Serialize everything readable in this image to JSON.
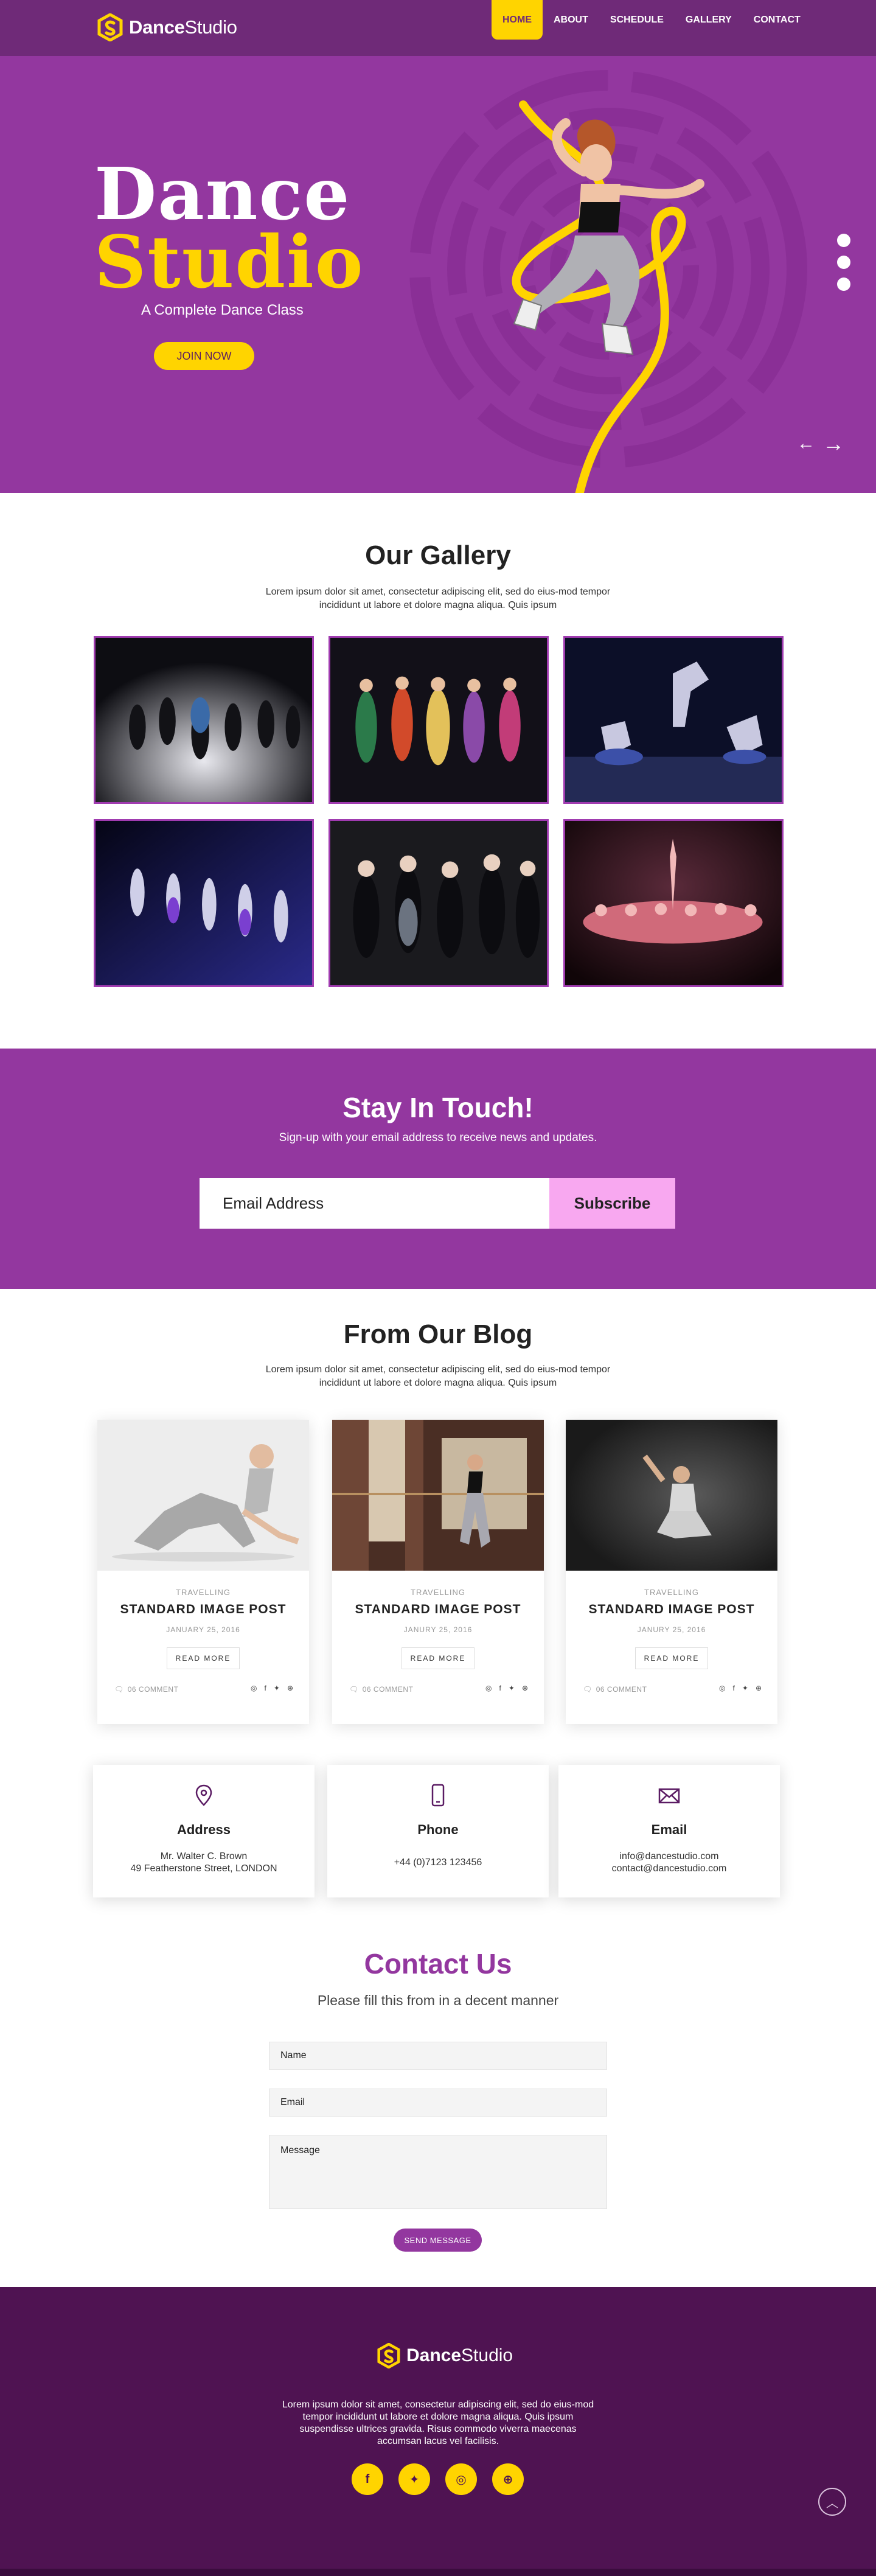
{
  "brand": {
    "name_bold": "Dance",
    "name_light": "Studio"
  },
  "nav": {
    "items": [
      "HOME",
      "ABOUT",
      "SCHEDULE",
      "GALLERY",
      "CONTACT"
    ],
    "active": "HOME"
  },
  "hero": {
    "title_line1": "Dance",
    "title_line2": "Studio",
    "tagline": "A Complete Dance Class",
    "cta": "JOIN NOW",
    "prev_arrow": "←",
    "next_arrow": "→"
  },
  "gallery": {
    "title": "Our Gallery",
    "subtitle": "Lorem ipsum dolor sit amet, consectetur adipiscing elit, sed do eius-mod tempor incididunt ut labore et dolore magna aliqua. Quis ipsum"
  },
  "newsletter": {
    "title": "Stay In Touch!",
    "subtitle": "Sign-up with your email address to receive news and updates.",
    "email_placeholder": "Email Address",
    "button": "Subscribe"
  },
  "blog": {
    "title": "From Our Blog",
    "subtitle": "Lorem ipsum dolor sit amet, consectetur adipiscing elit, sed do eius-mod tempor incididunt ut labore et dolore magna aliqua. Quis ipsum",
    "posts": [
      {
        "category": "TRAVELLING",
        "title": "STANDARD IMAGE POST",
        "date": "JANUARY 25, 2016",
        "more": "READ MORE",
        "comments": "06 COMMENT"
      },
      {
        "category": "TRAVELLING",
        "title": "STANDARD IMAGE POST",
        "date": "JANURY 25, 2016",
        "more": "READ MORE",
        "comments": "06 COMMENT"
      },
      {
        "category": "TRAVELLING",
        "title": "STANDARD IMAGE POST",
        "date": "JANURY 25, 2016",
        "more": "READ MORE",
        "comments": "06 COMMENT"
      }
    ]
  },
  "info": {
    "address": {
      "title": "Address",
      "line1": "Mr. Walter C. Brown",
      "line2": "49 Featherstone Street, LONDON"
    },
    "phone": {
      "title": "Phone",
      "line1": "+44 (0)7123 123456"
    },
    "email": {
      "title": "Email",
      "line1": "info@dancestudio.com",
      "line2": "contact@dancestudio.com"
    }
  },
  "contact": {
    "title": "Contact Us",
    "subtitle": "Please fill this from in a decent manner",
    "name_placeholder": "Name",
    "email_placeholder": "Email",
    "message_placeholder": "Message",
    "button": "SEND MESSAGE"
  },
  "footer": {
    "text": "Lorem ipsum dolor sit amet, consectetur adipiscing elit, sed do eius-mod tempor incididunt ut labore et dolore magna aliqua. Quis ipsum suspendisse ultrices gravida. Risus commodo viverra maecenas accumsan lacus vel facilisis.",
    "socials": [
      "facebook-icon",
      "twitter-icon",
      "instagram-icon",
      "globe-icon"
    ]
  },
  "colors": {
    "purple": "#93379f",
    "dark_purple": "#4f1352",
    "yellow": "#ffd400",
    "pink": "#f8a8f0"
  }
}
